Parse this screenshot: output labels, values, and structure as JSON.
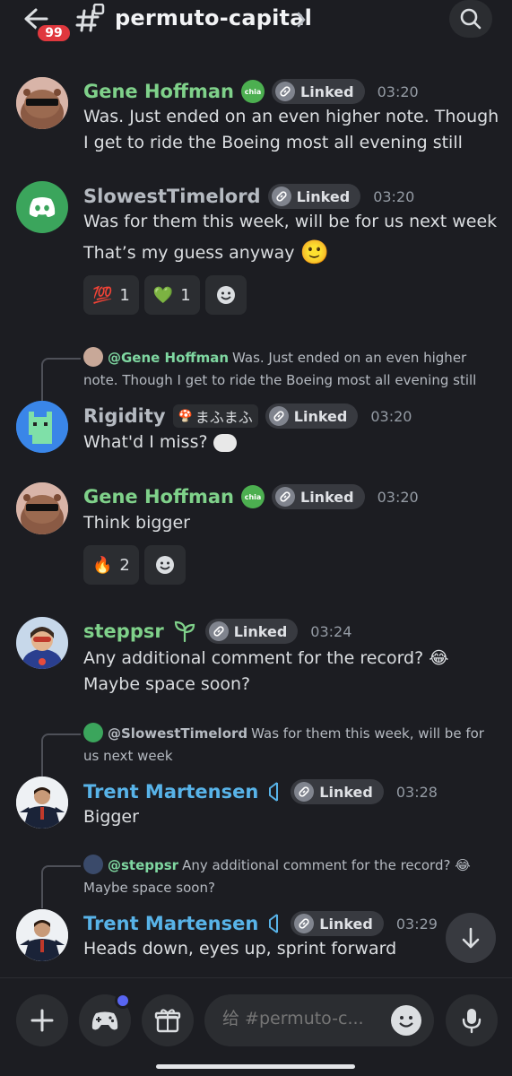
{
  "header": {
    "badge_count": "99",
    "channel_name": "permuto-capital",
    "icons": [
      "back-arrow-icon",
      "hash-thread-icon",
      "chevron-right-icon",
      "search-icon"
    ]
  },
  "linked_label": "Linked",
  "messages": [
    {
      "author": "Gene Hoffman",
      "author_color": "#7fd18a",
      "badge": "chia",
      "time": "03:20",
      "text": "Was. Just ended on an even higher note. Though I get to ride the Boeing most all evening still"
    },
    {
      "author": "SlowestTimelord",
      "author_color": "#b5bac1",
      "time": "03:20",
      "text": "Was for them this week, will be for us next week",
      "text2": "That’s my guess anyway",
      "reactions": [
        {
          "emoji": "💯",
          "count": "1"
        },
        {
          "emoji": "💚",
          "count": "1"
        }
      ]
    },
    {
      "reply": {
        "mention": "@Gene Hoffman",
        "text": "Was. Just ended on an even higher note. Though I get to ride the Boeing most all evening still"
      },
      "author": "Rigidity",
      "author_color": "#b5bac1",
      "tag": "まふまふ",
      "time": "03:20",
      "text": "What'd I miss?"
    },
    {
      "author": "Gene Hoffman",
      "author_color": "#7fd18a",
      "badge": "chia",
      "time": "03:20",
      "text": "Think bigger",
      "reactions": [
        {
          "emoji": "🔥",
          "count": "2"
        }
      ]
    },
    {
      "author": "steppsr",
      "author_color": "#7fd18a",
      "time": "03:24",
      "text": "Any additional comment for the record? 😂 Maybe space soon?"
    },
    {
      "reply": {
        "mention": "@SlowestTimelord",
        "text": "Was for them this week, will be for us next week"
      },
      "author": "Trent Martensen",
      "author_color": "#58b3e8",
      "time": "03:28",
      "text": "Bigger"
    },
    {
      "reply": {
        "mention": "@steppsr",
        "text": "Any additional comment for the record? 😂 Maybe space soon?"
      },
      "author": "Trent Martensen",
      "author_color": "#58b3e8",
      "time": "03:29",
      "text": "Heads down, eyes up, sprint forward"
    }
  ],
  "composer": {
    "placeholder": "给 #permuto-c..."
  },
  "colors": {
    "background": "#1c1d22",
    "badge_red": "#e0383e",
    "accent_blurple": "#5865f2"
  }
}
